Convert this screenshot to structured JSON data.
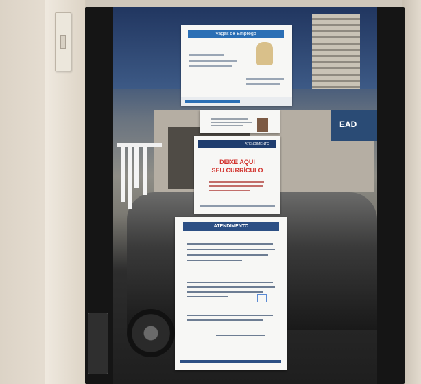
{
  "scene": {
    "flyer_top": {
      "header": "Vagas de Emprego"
    },
    "flyer_resume": {
      "header": "ATENDIMENTO",
      "headline_1": "DEIXE AQUI",
      "headline_2": "SEU CURRÍCULO"
    },
    "flyer_attendance": {
      "header": "ATENDIMENTO"
    },
    "street_sign": {
      "text": "EAD"
    }
  },
  "colors": {
    "resume_red": "#d2322d",
    "header_blue": "#2c4f84",
    "flyer_blue": "#2b6fb5"
  }
}
